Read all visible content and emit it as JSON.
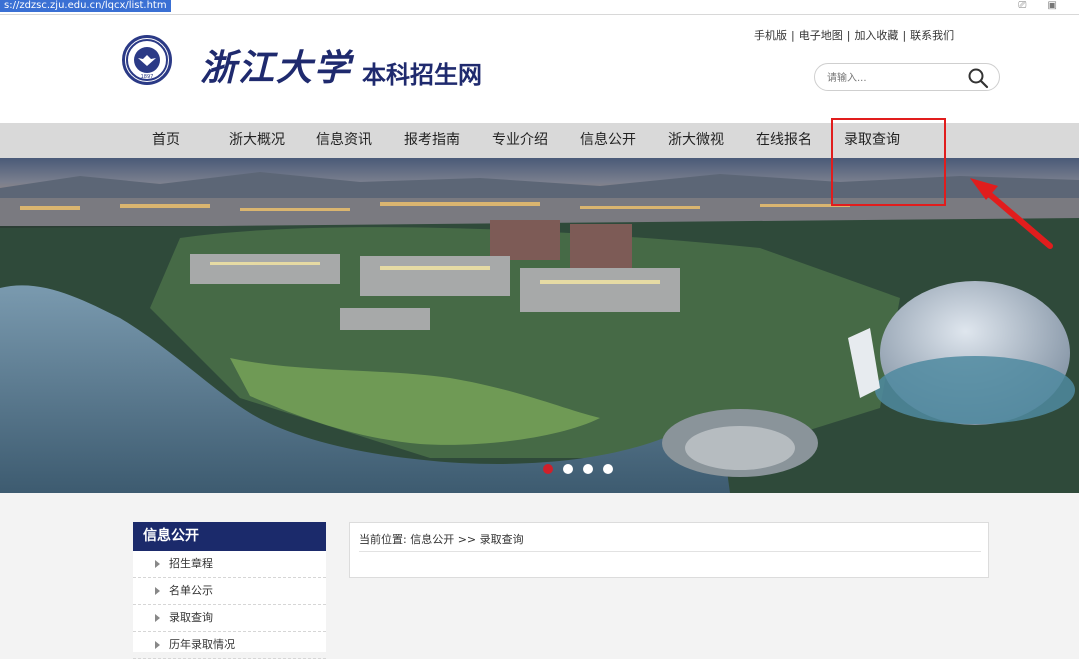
{
  "browser": {
    "url": "s://zdzsc.zju.edu.cn/lqcx/list.htm",
    "icons": [
      "tab-icon",
      "window-icon"
    ]
  },
  "header": {
    "calligraphy_logo": "浙江大学",
    "site_name": "本科招生网",
    "top_links": [
      "手机版",
      "电子地图",
      "加入收藏",
      "联系我们"
    ],
    "search": {
      "placeholder": "请输入..."
    }
  },
  "nav": {
    "items": [
      "首页",
      "浙大概况",
      "信息资讯",
      "报考指南",
      "专业介绍",
      "信息公开",
      "浙大微视",
      "在线报名",
      "录取查询"
    ],
    "highlight_color": "#e11d1d"
  },
  "banner": {
    "slides": 4,
    "active_slide": 1,
    "active_color": "#d0202a"
  },
  "sidebar": {
    "title": "信息公开",
    "items": [
      "招生章程",
      "名单公示",
      "录取查询",
      "历年录取情况"
    ],
    "title_bg": "#1b2a6b"
  },
  "breadcrumb": {
    "label": "当前位置:",
    "path": "信息公开 >> 录取查询"
  }
}
